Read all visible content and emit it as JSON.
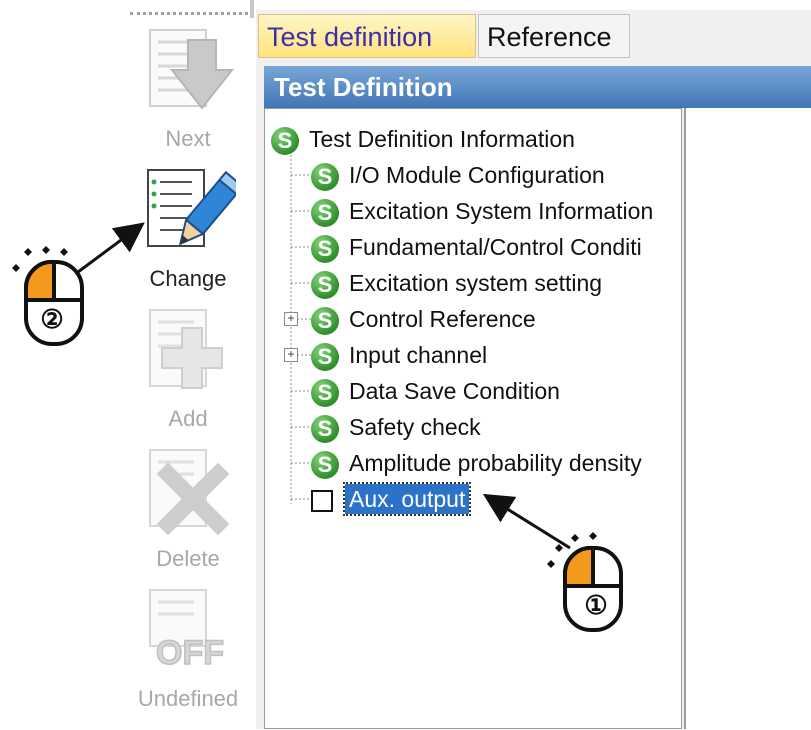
{
  "toolbar": {
    "buttons": [
      {
        "label": "Next",
        "icon": "arrow-down-icon",
        "enabled": false
      },
      {
        "label": "Change",
        "icon": "pencil-icon",
        "enabled": true
      },
      {
        "label": "Add",
        "icon": "plus-icon",
        "enabled": false
      },
      {
        "label": "Delete",
        "icon": "x-icon",
        "enabled": false
      },
      {
        "label": "Undefined",
        "icon": "off-icon",
        "enabled": false
      }
    ]
  },
  "tabs": [
    {
      "label": "Test definition",
      "active": true
    },
    {
      "label": "Reference",
      "active": false
    }
  ],
  "panel": {
    "title": "Test Definition"
  },
  "tree": {
    "root": "Test Definition Information",
    "items": [
      {
        "label": "I/O Module Configuration"
      },
      {
        "label": "Excitation System Information"
      },
      {
        "label": "Fundamental/Control Conditi"
      },
      {
        "label": "Excitation system setting"
      },
      {
        "label": "Control Reference"
      },
      {
        "label": "Input channel"
      },
      {
        "label": "Data Save Condition"
      },
      {
        "label": "Safety check"
      },
      {
        "label": "Amplitude probability density"
      }
    ],
    "selected": {
      "label": "Aux. output",
      "checked": false
    },
    "node_icon_letter": "S",
    "expand_symbol": "+"
  },
  "annotations": {
    "step1": "①",
    "step2": "②"
  },
  "colors": {
    "tab_active_text": "#3a2fb0",
    "header_bg": "#3f76b6",
    "selection_bg": "#2a73c8",
    "mouse_button": "#f39a1e"
  }
}
